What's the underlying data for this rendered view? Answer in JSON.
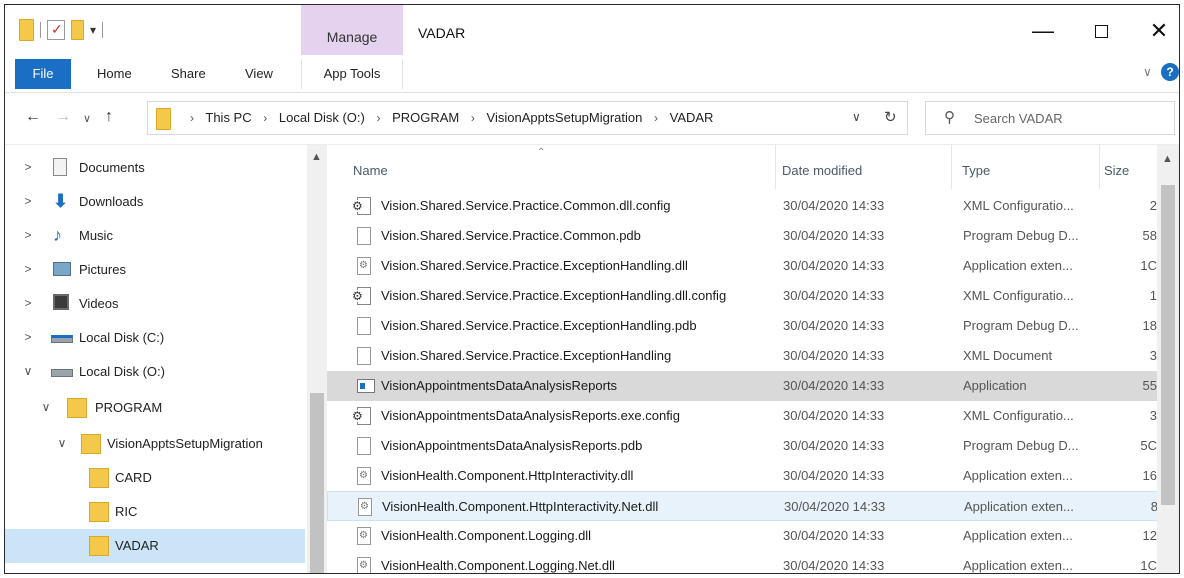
{
  "window": {
    "title": "VADAR",
    "contextual_tab": "Manage",
    "quick_access_arrow": "▾"
  },
  "ribbon": {
    "tabs": {
      "file": "File",
      "home": "Home",
      "share": "Share",
      "view": "View",
      "app_tools": "App Tools"
    },
    "help_glyph": "?"
  },
  "address": {
    "breadcrumbs": [
      "This PC",
      "Local Disk (O:)",
      "PROGRAM",
      "VisionApptsSetupMigration",
      "VADAR"
    ],
    "search_placeholder": "Search VADAR"
  },
  "navigation": {
    "items": [
      {
        "label": "Documents",
        "icon": "documents-icon",
        "expander": ">"
      },
      {
        "label": "Downloads",
        "icon": "downloads-icon",
        "expander": ">"
      },
      {
        "label": "Music",
        "icon": "music-icon",
        "expander": ">"
      },
      {
        "label": "Pictures",
        "icon": "pictures-icon",
        "expander": ">"
      },
      {
        "label": "Videos",
        "icon": "videos-icon",
        "expander": ">"
      },
      {
        "label": "Local Disk (C:)",
        "icon": "drive-icon",
        "expander": ">"
      },
      {
        "label": "Local Disk (O:)",
        "icon": "drive-icon",
        "expander": "∨"
      },
      {
        "label": "PROGRAM",
        "icon": "folder-icon",
        "expander": "∨"
      },
      {
        "label": "VisionApptsSetupMigration",
        "icon": "folder-icon",
        "expander": "∨"
      },
      {
        "label": "CARD",
        "icon": "folder-icon",
        "expander": ""
      },
      {
        "label": "RIC",
        "icon": "folder-icon",
        "expander": ""
      },
      {
        "label": "VADAR",
        "icon": "folder-icon",
        "expander": "",
        "selected": true
      }
    ]
  },
  "file_list": {
    "columns": {
      "name": "Name",
      "date_modified": "Date modified",
      "type": "Type",
      "size": "Size"
    },
    "sorted_by": "Name",
    "rows": [
      {
        "name": "Vision.Shared.Service.Practice.Common.dll.config",
        "date": "30/04/2020 14:33",
        "type": "XML Configuratio...",
        "size": "2",
        "icon": "config-file-icon"
      },
      {
        "name": "Vision.Shared.Service.Practice.Common.pdb",
        "date": "30/04/2020 14:33",
        "type": "Program Debug D...",
        "size": "58",
        "icon": "file-icon"
      },
      {
        "name": "Vision.Shared.Service.Practice.ExceptionHandling.dll",
        "date": "30/04/2020 14:33",
        "type": "Application exten...",
        "size": "1C",
        "icon": "dll-file-icon"
      },
      {
        "name": "Vision.Shared.Service.Practice.ExceptionHandling.dll.config",
        "date": "30/04/2020 14:33",
        "type": "XML Configuratio...",
        "size": "1",
        "icon": "config-file-icon"
      },
      {
        "name": "Vision.Shared.Service.Practice.ExceptionHandling.pdb",
        "date": "30/04/2020 14:33",
        "type": "Program Debug D...",
        "size": "18",
        "icon": "file-icon"
      },
      {
        "name": "Vision.Shared.Service.Practice.ExceptionHandling",
        "date": "30/04/2020 14:33",
        "type": "XML Document",
        "size": "3",
        "icon": "file-icon"
      },
      {
        "name": "VisionAppointmentsDataAnalysisReports",
        "date": "30/04/2020 14:33",
        "type": "Application",
        "size": "55",
        "icon": "application-icon",
        "selected": true
      },
      {
        "name": "VisionAppointmentsDataAnalysisReports.exe.config",
        "date": "30/04/2020 14:33",
        "type": "XML Configuratio...",
        "size": "3",
        "icon": "config-file-icon"
      },
      {
        "name": "VisionAppointmentsDataAnalysisReports.pdb",
        "date": "30/04/2020 14:33",
        "type": "Program Debug D...",
        "size": "5C",
        "icon": "file-icon"
      },
      {
        "name": "VisionHealth.Component.HttpInteractivity.dll",
        "date": "30/04/2020 14:33",
        "type": "Application exten...",
        "size": "16",
        "icon": "dll-file-icon"
      },
      {
        "name": "VisionHealth.Component.HttpInteractivity.Net.dll",
        "date": "30/04/2020 14:33",
        "type": "Application exten...",
        "size": "8",
        "icon": "dll-file-icon",
        "hover": true
      },
      {
        "name": "VisionHealth.Component.Logging.dll",
        "date": "30/04/2020 14:33",
        "type": "Application exten...",
        "size": "12",
        "icon": "dll-file-icon"
      },
      {
        "name": "VisionHealth.Component.Logging.Net.dll",
        "date": "30/04/2020 14:33",
        "type": "Application exten...",
        "size": "1C",
        "icon": "dll-file-icon"
      }
    ]
  },
  "colors": {
    "file_tab": "#1a6fc4",
    "manage_tab": "#e4d2ee",
    "selected_nav": "#cce4f7",
    "selected_row": "#d9d9d9",
    "hover_row": "#e8f2fb",
    "folder": "#f4c84a"
  }
}
